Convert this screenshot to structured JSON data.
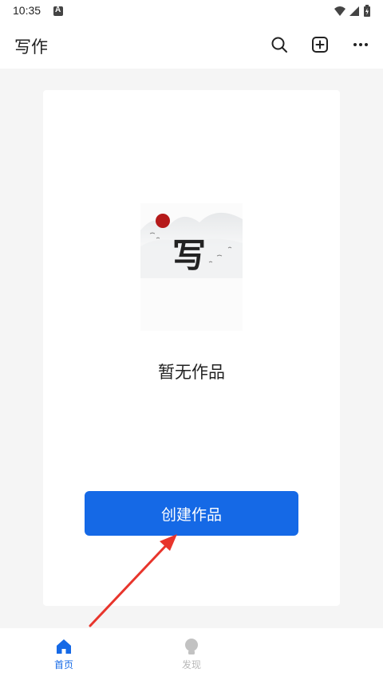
{
  "status_bar": {
    "time": "10:35",
    "icons": [
      "a-notification-icon",
      "wifi-icon",
      "signal-icon",
      "battery-icon"
    ]
  },
  "header": {
    "title": "写作",
    "actions": [
      "search-icon",
      "add-icon",
      "more-icon"
    ]
  },
  "main": {
    "empty_text": "暂无作品",
    "illustration_glyph": "写",
    "create_button_label": "创建作品"
  },
  "bottom_nav": {
    "items": [
      {
        "label": "首页",
        "icon": "home-icon",
        "active": true
      },
      {
        "label": "发现",
        "icon": "lightbulb-icon",
        "active": false
      }
    ]
  },
  "colors": {
    "accent": "#1569e6",
    "background": "#f5f5f5",
    "surface": "#ffffff",
    "annotation_arrow": "#e8352c",
    "inactive": "#b8b8b8"
  }
}
